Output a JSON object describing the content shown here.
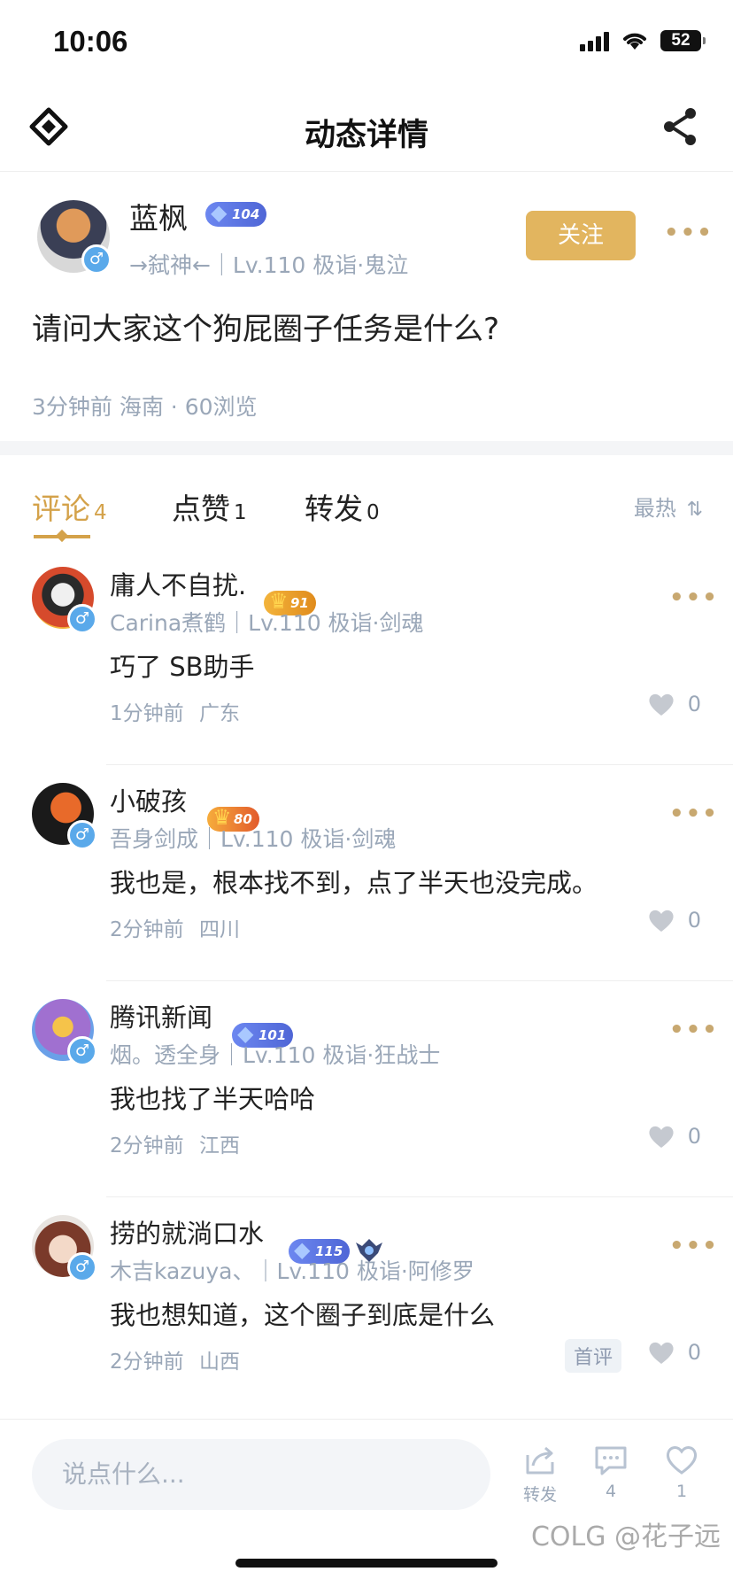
{
  "status": {
    "time": "10:06",
    "battery": "52"
  },
  "nav": {
    "title": "动态详情"
  },
  "post": {
    "author": "蓝枫",
    "level_badge": "104",
    "sub": "→弑神←｜Lv.110 极诣·鬼泣",
    "follow_label": "关注",
    "more": "•••",
    "content": "请问大家这个狗屁圈子任务是什么?",
    "meta": "3分钟前 海南 · 60浏览"
  },
  "tabs": [
    {
      "label": "评论",
      "count": "4"
    },
    {
      "label": "点赞",
      "count": "1"
    },
    {
      "label": "转发",
      "count": "0"
    }
  ],
  "sort_label": "最热",
  "comments": [
    {
      "name": "庸人不自扰.",
      "badge": "91",
      "sub": "Carina煮鹤｜Lv.110 极诣·剑魂",
      "text": "巧了 SB助手",
      "time": "1分钟前",
      "region": "广东",
      "likes": "0"
    },
    {
      "name": "小破孩",
      "badge": "80",
      "sub": "吾身剑成｜Lv.110 极诣·剑魂",
      "text": "我也是，根本找不到，点了半天也没完成。",
      "time": "2分钟前",
      "region": "四川",
      "likes": "0"
    },
    {
      "name": "腾讯新闻",
      "badge": "101",
      "sub": "烟。透全身｜Lv.110 极诣·狂战士",
      "text": "我也找了半天哈哈",
      "time": "2分钟前",
      "region": "江西",
      "likes": "0"
    },
    {
      "name": "捞的就淌口水",
      "badge": "115",
      "sub": "木吉kazuya、｜Lv.110 极诣·阿修罗",
      "text": "我也想知道，这个圈子到底是什么",
      "time": "2分钟前",
      "region": "山西",
      "likes": "0",
      "tag": "首评"
    }
  ],
  "bottom": {
    "placeholder": "说点什么...",
    "repost_label": "转发",
    "comment_count": "4",
    "like_count": "1"
  },
  "watermark": "COLG @花子远"
}
